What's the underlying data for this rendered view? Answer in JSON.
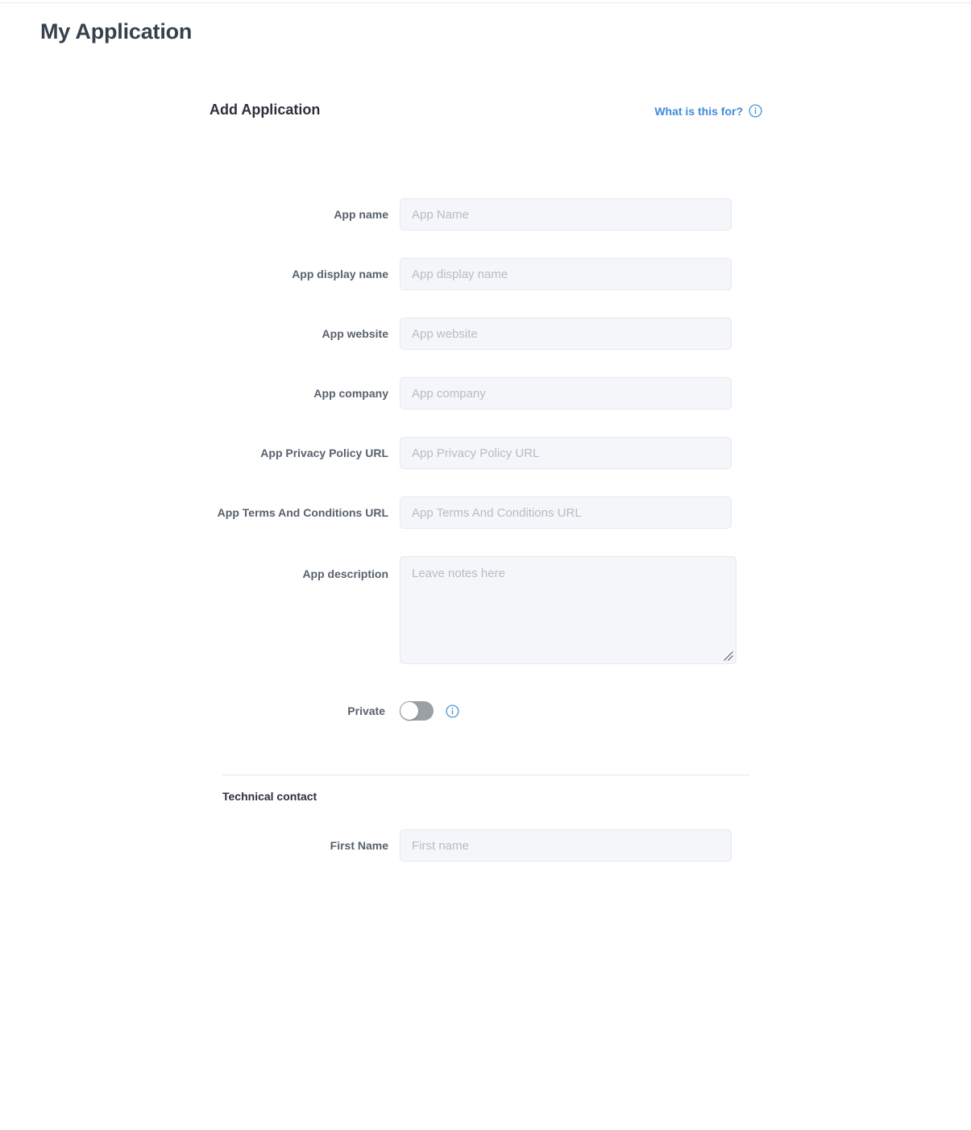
{
  "page": {
    "title": "My Application"
  },
  "card": {
    "title": "Add Application",
    "help_link": {
      "label": "What is this for?",
      "icon": "info-icon",
      "color": "#3f8dd6"
    }
  },
  "form": {
    "fields": [
      {
        "label": "App name",
        "placeholder": "App Name",
        "value": "",
        "type": "text"
      },
      {
        "label": "App display name",
        "placeholder": "App display name",
        "value": "",
        "type": "text"
      },
      {
        "label": "App website",
        "placeholder": "App website",
        "value": "",
        "type": "text"
      },
      {
        "label": "App company",
        "placeholder": "App company",
        "value": "",
        "type": "text"
      },
      {
        "label": "App Privacy Policy URL",
        "placeholder": "App Privacy Policy URL",
        "value": "",
        "type": "text"
      },
      {
        "label": "App Terms And Conditions URL",
        "placeholder": "App Terms And Conditions URL",
        "value": "",
        "type": "text"
      }
    ],
    "description": {
      "label": "App description",
      "placeholder": "Leave notes here",
      "value": "",
      "resize_handle_icon": "resize-grip-icon"
    },
    "private_toggle": {
      "label": "Private",
      "state": "off",
      "track_color": "#9aa0a6",
      "knob_color": "#ffffff",
      "info_icon": "info-icon"
    }
  },
  "technical_contact": {
    "heading": "Technical contact",
    "fields": [
      {
        "label": "First Name",
        "placeholder": "First name",
        "value": "",
        "type": "text"
      }
    ]
  },
  "colors": {
    "accent": "#3f8dd6",
    "input_background": "#f4f6f9",
    "input_border": "#e6e9ee",
    "label_text": "#59616e",
    "heading_text": "#2b303a",
    "placeholder_text": "#b7bcc5",
    "divider": "#e6e6e8"
  }
}
